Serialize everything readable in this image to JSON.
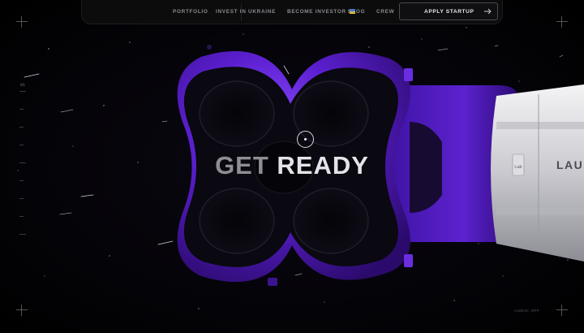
{
  "nav": {
    "links": [
      "PORTFOLIO",
      "INVEST IN UKRAINE",
      "BECOME INVESTOR",
      "BLOG",
      "CREW"
    ],
    "apply_label": "APPLY STARTUP"
  },
  "hero": {
    "headline_part1": "GET",
    "headline_part2": "READY"
  },
  "side": {
    "section_number": "01",
    "audio_label": "AUDIO: OFF"
  },
  "rocket": {
    "brand_text": "LAU",
    "badge_text": "Lab"
  },
  "colors": {
    "background": "#000000",
    "accent_purple": "#5b21b6",
    "purple_light": "#7c3aed",
    "nav_bg": "#0c0c0d"
  }
}
